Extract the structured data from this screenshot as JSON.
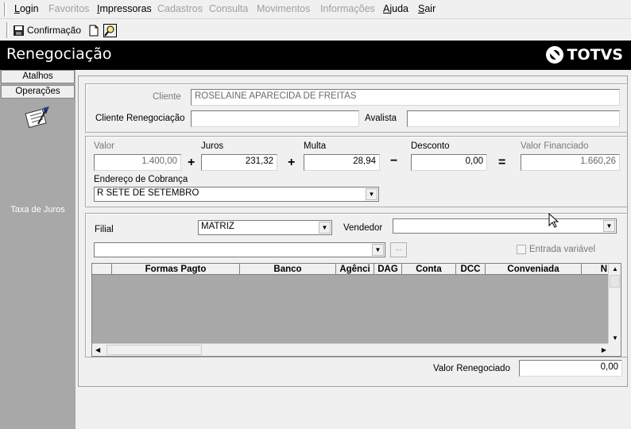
{
  "menu": [
    {
      "label": "Login",
      "enabled": true
    },
    {
      "label": "Favoritos",
      "enabled": false
    },
    {
      "label": "Impressoras",
      "enabled": true
    },
    {
      "label": "Cadastros",
      "enabled": false
    },
    {
      "label": "Consulta",
      "enabled": false
    },
    {
      "label": "Movimentos",
      "enabled": false
    },
    {
      "label": "Informações",
      "enabled": false
    },
    {
      "label": "Ajuda",
      "enabled": true
    },
    {
      "label": "Sair",
      "enabled": true
    }
  ],
  "toolbar": {
    "confirm_label": "Confirmação",
    "new_icon": "new-document-icon",
    "search_icon": "search-icon"
  },
  "header": {
    "title": "Renegociação",
    "logo_text": "TOTVS"
  },
  "sidebar": {
    "atalhos": "Atalhos",
    "operacoes": "Operações",
    "item_label": "Taxa de Juros",
    "item_icon": "interest-rate-icon"
  },
  "cliente": {
    "label": "Cliente",
    "value": "ROSELAINE APARECIDA DE FREITAS",
    "reneg_label": "Cliente Renegociação",
    "reneg_value": "",
    "avalista_label": "Avalista",
    "avalista_value": ""
  },
  "valores": {
    "valor_label": "Valor",
    "valor": "1.400,00",
    "juros_label": "Juros",
    "juros": "231,32",
    "multa_label": "Multa",
    "multa": "28,94",
    "desconto_label": "Desconto",
    "desconto": "0,00",
    "financiado_label": "Valor Financiado",
    "financiado": "1.660,26",
    "plus": "+",
    "minus": "−",
    "equals": "=",
    "endereco_label": "Endereço de Cobrança",
    "endereco": "R SETE DE SETEMBRO"
  },
  "filial": {
    "label": "Filial",
    "value": "MATRIZ",
    "vendedor_label": "Vendedor",
    "vendedor_value": "",
    "combo2_value": "",
    "ellipsis": "...",
    "entrada_label": "Entrada variável"
  },
  "grid": {
    "columns": [
      "",
      "Formas Pagto",
      "Banco",
      "Agênci",
      "DAG",
      "Conta",
      "DCC",
      "Conveniada",
      "N"
    ]
  },
  "footer": {
    "valor_reneg_label": "Valor Renegociado",
    "valor_reneg": "0,00"
  },
  "colors": {
    "titlebar": "#000000",
    "sidebar": "#a8a8a8",
    "grid_bg": "#a8a8a8"
  }
}
